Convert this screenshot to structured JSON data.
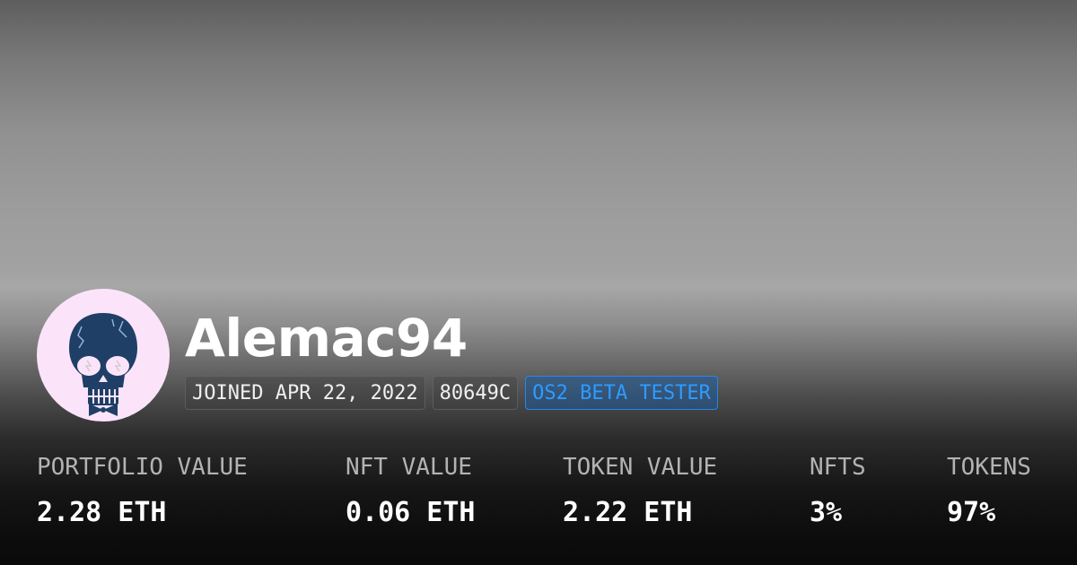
{
  "profile": {
    "username": "Alemac94",
    "avatar_icon": "skull-icon",
    "badges": [
      {
        "label": "JOINED APR 22, 2022"
      },
      {
        "label": "80649C"
      },
      {
        "label": "OS2 BETA TESTER",
        "color": "#2d9cff"
      }
    ]
  },
  "stats": [
    {
      "label": "PORTFOLIO VALUE",
      "value": "2.28 ETH"
    },
    {
      "label": "NFT VALUE",
      "value": "0.06 ETH"
    },
    {
      "label": "TOKEN VALUE",
      "value": "2.22 ETH"
    },
    {
      "label": "NFTS",
      "value": "3%"
    },
    {
      "label": "TOKENS",
      "value": "97%"
    }
  ],
  "colors": {
    "avatar_background": "#fbe4fa",
    "skull": "#1f3f66",
    "accent": "#2d9cff"
  }
}
